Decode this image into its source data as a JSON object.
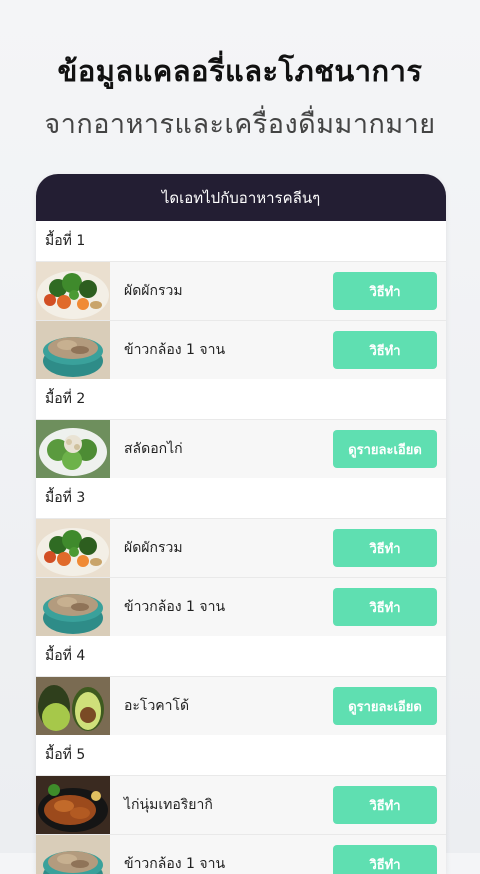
{
  "promo": {
    "title": "ข้อมูลแคลอรี่และโภชนาการ",
    "subtitle": "จากอาหารและเครื่องดื่มมากมาย"
  },
  "app": {
    "header_title": "ไดเอทไปกับอาหารคลีนๆ"
  },
  "meals": [
    {
      "label": "มื้อที่ 1",
      "items": [
        {
          "name": "ผัดผักรวม",
          "button": "วิธีทำ",
          "image": "stir-fried-vegetables"
        },
        {
          "name": "ข้าวกล้อง 1 จาน",
          "button": "วิธีทำ",
          "image": "brown-rice"
        }
      ]
    },
    {
      "label": "มื้อที่ 2",
      "items": [
        {
          "name": "สลัดอกไก่",
          "button": "ดูรายละเอียด",
          "image": "chicken-salad"
        }
      ]
    },
    {
      "label": "มื้อที่ 3",
      "items": [
        {
          "name": "ผัดผักรวม",
          "button": "วิธีทำ",
          "image": "stir-fried-vegetables"
        },
        {
          "name": "ข้าวกล้อง 1 จาน",
          "button": "วิธีทำ",
          "image": "brown-rice"
        }
      ]
    },
    {
      "label": "มื้อที่ 4",
      "items": [
        {
          "name": "อะโวคาโด้",
          "button": "ดูรายละเอียด",
          "image": "avocado"
        }
      ]
    },
    {
      "label": "มื้อที่ 5",
      "items": [
        {
          "name": "ไก่นุ่มเทอริยากิ",
          "button": "วิธีทำ",
          "image": "teriyaki-chicken"
        },
        {
          "name": "ข้าวกล้อง 1 จาน",
          "button": "วิธีทำ",
          "image": "brown-rice"
        }
      ]
    }
  ],
  "colors": {
    "header_bg": "#231e33",
    "button_bg": "#5fdfb1",
    "row_bg": "#f7f7f7"
  }
}
